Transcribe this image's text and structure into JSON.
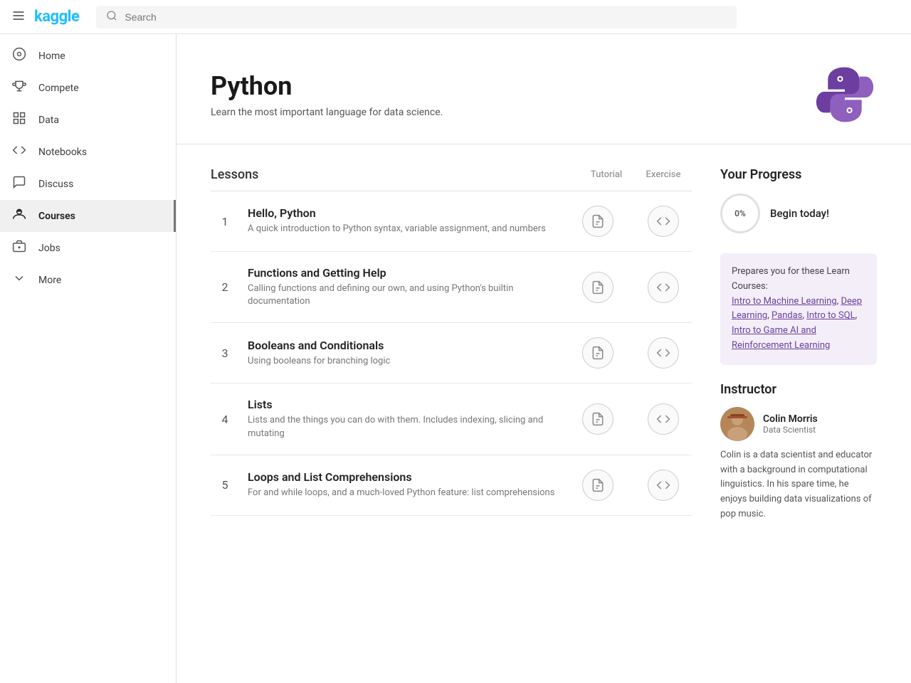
{
  "topbar": {
    "menu_label": "menu",
    "logo": "kaggle",
    "search_placeholder": "Search"
  },
  "sidebar": {
    "items": [
      {
        "id": "home",
        "label": "Home",
        "icon": "⊙"
      },
      {
        "id": "compete",
        "label": "Compete",
        "icon": "🏆"
      },
      {
        "id": "data",
        "label": "Data",
        "icon": "⊞"
      },
      {
        "id": "notebooks",
        "label": "Notebooks",
        "icon": "<>"
      },
      {
        "id": "discuss",
        "label": "Discuss",
        "icon": "💬"
      },
      {
        "id": "courses",
        "label": "Courses",
        "icon": "🎓",
        "active": true
      },
      {
        "id": "jobs",
        "label": "Jobs",
        "icon": "💼"
      },
      {
        "id": "more",
        "label": "More",
        "icon": "∨"
      }
    ]
  },
  "hero": {
    "title": "Python",
    "subtitle": "Learn the most important language for data science."
  },
  "lessons": {
    "heading": "Lessons",
    "col_tutorial": "Tutorial",
    "col_exercise": "Exercise",
    "rows": [
      {
        "num": "1",
        "name": "Hello, Python",
        "desc": "A quick introduction to Python syntax, variable assignment, and numbers"
      },
      {
        "num": "2",
        "name": "Functions and Getting Help",
        "desc": "Calling functions and defining our own, and using Python's builtin documentation"
      },
      {
        "num": "3",
        "name": "Booleans and Conditionals",
        "desc": "Using booleans for branching logic"
      },
      {
        "num": "4",
        "name": "Lists",
        "desc": "Lists and the things you can do with them. Includes indexing, slicing and mutating"
      },
      {
        "num": "5",
        "name": "Loops and List Comprehensions",
        "desc": "For and while loops, and a much-loved Python feature: list comprehensions"
      }
    ]
  },
  "progress": {
    "title": "Your Progress",
    "percent": "0%",
    "message": "Begin today!",
    "prepares_prefix": "Prepares you for these Learn Courses:",
    "courses": [
      {
        "label": "Intro to Machine Learning",
        "link": true
      },
      {
        "label": ", ",
        "link": false
      },
      {
        "label": "Deep Learning",
        "link": true
      },
      {
        "label": ", ",
        "link": false
      },
      {
        "label": "Pandas",
        "link": true
      },
      {
        "label": ", ",
        "link": false
      },
      {
        "label": "Intro to SQL",
        "link": true
      },
      {
        "label": ", ",
        "link": false
      },
      {
        "label": "Intro to Game AI and Reinforcement Learning",
        "link": true
      }
    ]
  },
  "instructor": {
    "title": "Instructor",
    "name": "Colin Morris",
    "role": "Data Scientist",
    "bio": "Colin is a data scientist and educator with a background in computational linguistics. In his spare time, he enjoys building data visualizations of pop music."
  }
}
